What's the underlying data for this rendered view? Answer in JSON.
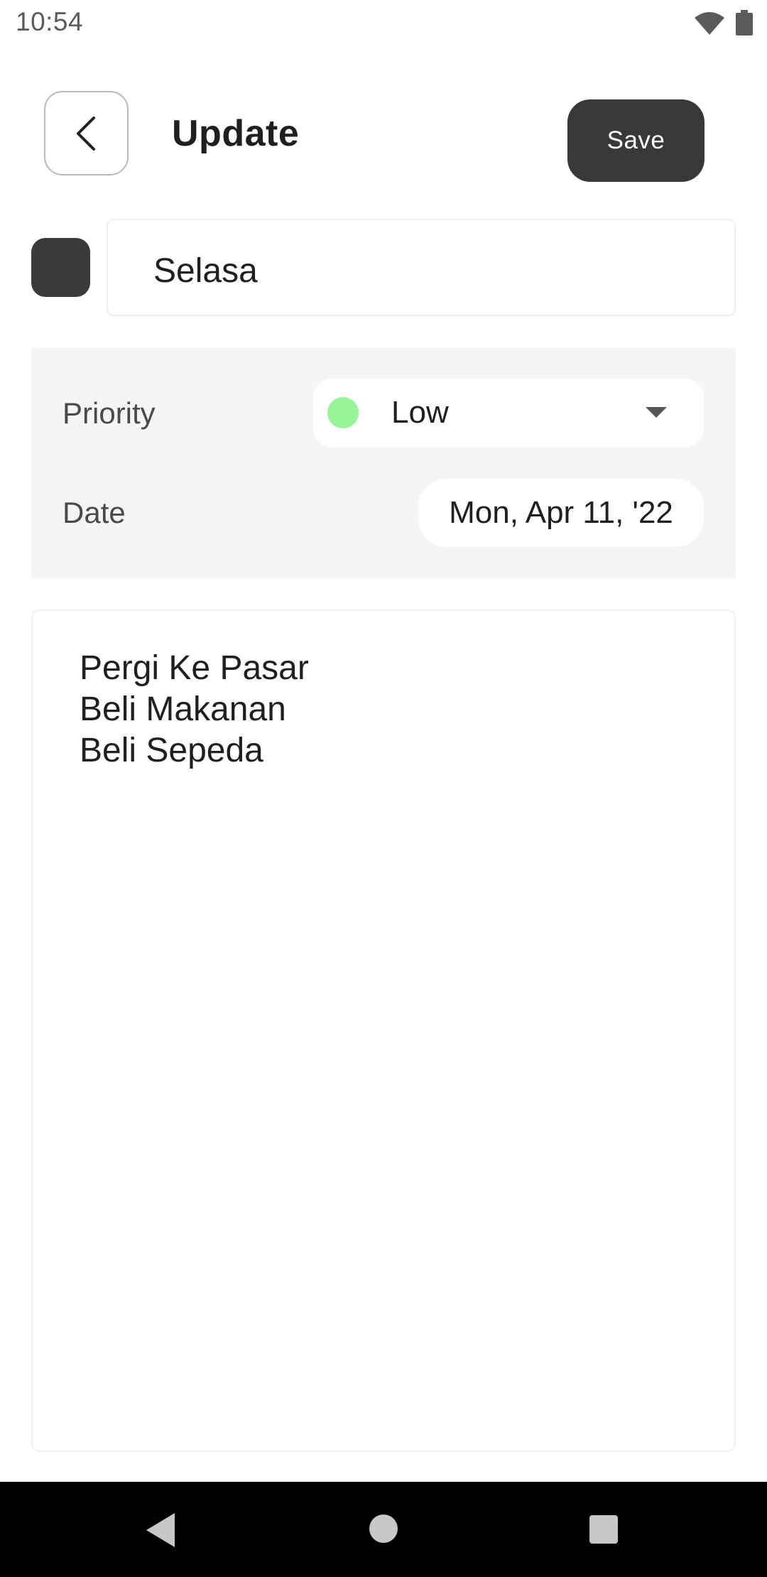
{
  "status_bar": {
    "time": "10:54",
    "icons": [
      "wifi-icon",
      "battery-icon"
    ]
  },
  "header": {
    "back_icon": "chevron-left-icon",
    "title": "Update",
    "save_label": "Save"
  },
  "note": {
    "color": "#3a3a3a",
    "title": "Selasa",
    "priority": {
      "label": "Priority",
      "value": "Low",
      "indicator_color": "#96f596"
    },
    "date": {
      "label": "Date",
      "value": "Mon, Apr 11, '22"
    },
    "body_lines": [
      "Pergi Ke Pasar",
      "Beli Makanan",
      "Beli Sepeda"
    ]
  },
  "colors": {
    "accent_dark": "#383838",
    "panel_bg": "#f4f5f7"
  },
  "nav_bar": {
    "icons": [
      "nav-back-icon",
      "nav-home-icon",
      "nav-recents-icon"
    ]
  }
}
